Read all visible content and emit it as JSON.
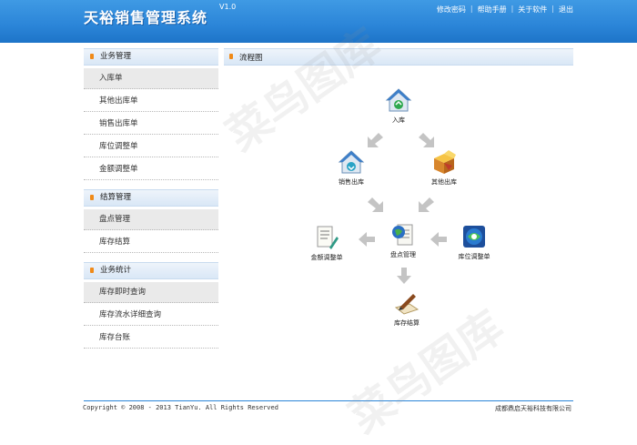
{
  "header": {
    "app_title": "天裕销售管理系统",
    "version": "V1.0",
    "links": [
      "修改密码",
      "帮助手册",
      "关于软件",
      "退出"
    ],
    "separator": "|"
  },
  "sidebar": {
    "groups": [
      {
        "title": "业务管理",
        "items": [
          "入库单",
          "其他出库单",
          "销售出库单",
          "库位调整单",
          "金额调整单"
        ]
      },
      {
        "title": "结算管理",
        "items": [
          "盘点管理",
          "库存结算"
        ]
      },
      {
        "title": "业务统计",
        "items": [
          "库存即时查询",
          "库存流水详细查询",
          "库存台账"
        ]
      }
    ]
  },
  "content": {
    "title": "流程图",
    "nodes": {
      "inbound": "入库",
      "sales_out": "销售出库",
      "other_out": "其他出库",
      "amount_adjust": "金额调整单",
      "inventory": "盘点管理",
      "location_adjust": "库位调整单",
      "settlement": "库存结算"
    }
  },
  "footer": {
    "copyright": "Copyright © 2008 - 2013 TianYu. All Rights Reserved",
    "company": "成都鼎启天裕科技有限公司"
  },
  "watermark": "菜鸟图库",
  "colors": {
    "header_blue": "#2b85d8",
    "bullet_orange": "#f08a18",
    "arrow_gray": "#c4c4c4"
  }
}
